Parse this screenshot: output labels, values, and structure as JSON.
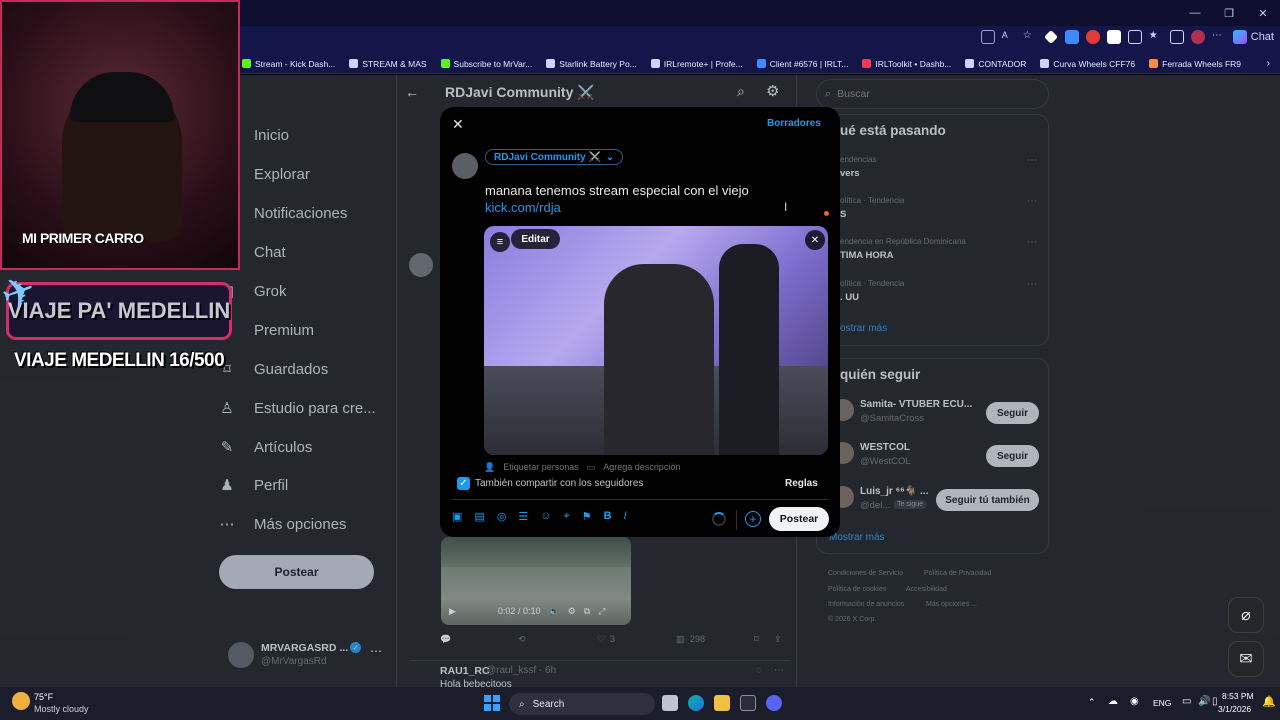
{
  "browser": {
    "extension_chat_label": "Chat",
    "bookmarks": [
      {
        "label": "Stream - Kick Dash...",
        "color": "#53fc18"
      },
      {
        "label": "STREAM & MAS",
        "color": "#cfd3ff"
      },
      {
        "label": "Subscribe to MrVar...",
        "color": "#53fc18"
      },
      {
        "label": "Starlink Battery Po...",
        "color": "#cfd3ff"
      },
      {
        "label": "IRLremote+ | Profe...",
        "color": "#cfd3ff"
      },
      {
        "label": "Client #6576 | IRLT...",
        "color": "#3c8cff"
      },
      {
        "label": "IRLToolkit • Dashb...",
        "color": "#ff3355"
      },
      {
        "label": "CONTADOR",
        "color": "#cfd3ff"
      },
      {
        "label": "Curva Wheels CFF76",
        "color": "#cfd3ff"
      },
      {
        "label": "Ferrada Wheels FR9",
        "color": "#ff8844"
      }
    ]
  },
  "nav": {
    "items": [
      {
        "label": "Inicio",
        "icon": "home-icon",
        "glyph": "⌂"
      },
      {
        "label": "Explorar",
        "icon": "search-icon",
        "glyph": "⌕"
      },
      {
        "label": "Notificaciones",
        "icon": "bell-icon",
        "glyph": "◔"
      },
      {
        "label": "Chat",
        "icon": "chat-icon",
        "glyph": "✉"
      },
      {
        "label": "Grok",
        "icon": "grok-icon",
        "glyph": "◩"
      },
      {
        "label": "Premium",
        "icon": "x-premium-icon",
        "glyph": "✕"
      },
      {
        "label": "Guardados",
        "icon": "bookmark-icon",
        "glyph": "⌑"
      },
      {
        "label": "Estudio para cre...",
        "icon": "studio-icon",
        "glyph": "♙"
      },
      {
        "label": "Artículos",
        "icon": "articles-icon",
        "glyph": "✎"
      },
      {
        "label": "Perfil",
        "icon": "profile-icon",
        "glyph": "♟"
      },
      {
        "label": "Más opciones",
        "icon": "more-icon",
        "glyph": "⋯"
      }
    ],
    "post_button": "Postear",
    "account_name": "MRVARGASRD ...",
    "account_handle": "@MrVargasRd"
  },
  "community": {
    "title": "RDJavi Community ⚔️"
  },
  "sidebar": {
    "search_placeholder": "Buscar",
    "trends_title": "ué está pasando",
    "trends": [
      {
        "category": "endencias",
        "name": "vers"
      },
      {
        "category": "olítica · Tendencia",
        "name": "S"
      },
      {
        "category": "endencia en República Dominicana",
        "name": "TIMA HORA"
      },
      {
        "category": "olítica · Tendencia",
        "name": ". UU"
      }
    ],
    "trends_more": "ostrar más",
    "who_title": "quién seguir",
    "who": [
      {
        "name": "Samita- VTUBER ECU...",
        "handle": "@SamitaCross",
        "button": "Seguir"
      },
      {
        "name": "WESTCOL",
        "handle": "@WestCOL",
        "button": "Seguir"
      },
      {
        "name": "Luis_jr ⁶⁶🐐 ...",
        "handle": "@del...",
        "badge": "Te sigue",
        "button": "Seguir tú también"
      }
    ],
    "who_more": "Mostrar más",
    "footer": [
      "Condiciones de Servicio",
      "Política de Privacidad",
      "Política de cookies",
      "Accesibilidad",
      "Información de anuncios",
      "Más opciones ...",
      "© 2026 X Corp."
    ]
  },
  "background_post": {
    "video_time": "0:02 / 0:10",
    "likes": "3",
    "views": "298",
    "next_author": "RAU1_RC",
    "next_handle": "@raul_kssf · 6h",
    "next_text": "Hola bebecitoos"
  },
  "modal": {
    "drafts_label": "Borradores",
    "audience": "RDJavi Community ⚔️",
    "text": "manana tenemos stream especial con el viejo",
    "link": "kick.com/rdja",
    "edit_label": "Editar",
    "tag_people": "Etiquetar personas",
    "add_description": "Agrega descripción",
    "share_label": "También compartir con los seguidores",
    "rules_label": "Reglas",
    "post_button": "Postear"
  },
  "overlay": {
    "sticker_top": "MI PRIMER CARRO",
    "banner": "VIAJE PA' MEDELLIN",
    "progress_text": "VIAJE MEDELLIN 16/500"
  },
  "taskbar": {
    "weather_temp": "75°F",
    "weather_text": "Mostly cloudy",
    "search_label": "Search",
    "language": "ENG",
    "time": "8:53 PM",
    "date": "3/1/2026"
  },
  "colors": {
    "accent": "#1d9bf0",
    "page_bg": "#18191a",
    "modal_bg": "#000000",
    "chrome": "#14164a"
  }
}
